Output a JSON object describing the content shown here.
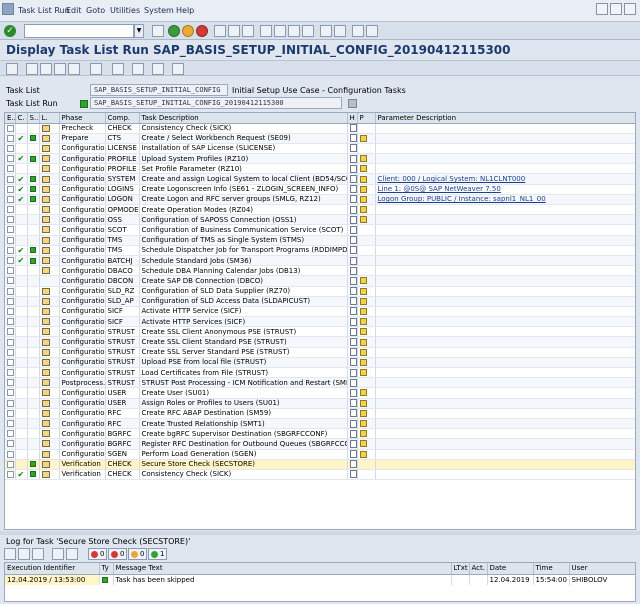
{
  "menu": {
    "items": [
      "Task List Run",
      "Edit",
      "Goto",
      "Utilities",
      "System",
      "Help"
    ]
  },
  "window": {
    "title": "Display Task List Run SAP_BASIS_SETUP_INITIAL_CONFIG_20190412115300"
  },
  "header": {
    "task_list_label": "Task List",
    "task_list_value": "SAP_BASIS_SETUP_INITIAL_CONFIG",
    "task_list_desc": "Initial Setup Use Case - Configuration Tasks",
    "task_list_run_label": "Task List Run",
    "task_list_run_value": "SAP_BASIS_SETUP_INITIAL_CONFIG_20190412115300"
  },
  "grid": {
    "columns": [
      "E..",
      "C.",
      "S..",
      "L.",
      "Phase",
      "Comp.",
      "Task Description",
      "H",
      "P",
      "Parameter Description"
    ],
    "rows": [
      {
        "e": true,
        "c": "",
        "s": false,
        "l": true,
        "phase": "Precheck",
        "comp": "CHECK",
        "desc": "Consistency Check (SICK)",
        "h": true,
        "p": false,
        "param": ""
      },
      {
        "e": true,
        "c": "✔",
        "s": true,
        "l": true,
        "phase": "Prepare",
        "comp": "CTS",
        "desc": "Create / Select Workbench Request (SE09)",
        "h": true,
        "p": true,
        "param": ""
      },
      {
        "e": true,
        "c": "",
        "s": false,
        "l": true,
        "phase": "Configuration",
        "comp": "LICENSE",
        "desc": "Installation of SAP License (SLICENSE)",
        "h": true,
        "p": false,
        "param": ""
      },
      {
        "e": true,
        "c": "✔",
        "s": true,
        "l": true,
        "phase": "Configuration",
        "comp": "PROFILE",
        "desc": "Upload System Profiles (RZ10)",
        "h": true,
        "p": true,
        "param": ""
      },
      {
        "e": true,
        "c": "",
        "s": false,
        "l": true,
        "phase": "Configuration",
        "comp": "PROFILE",
        "desc": "Set Profile Parameter (RZ10)",
        "h": true,
        "p": true,
        "param": ""
      },
      {
        "e": true,
        "c": "✔",
        "s": true,
        "l": true,
        "phase": "Configuration",
        "comp": "SYSTEM",
        "desc": "Create and assign Logical System to local Client (BD54/SCC4)",
        "h": true,
        "p": true,
        "param": "Client: 000 / Logical System: NL1CLNT000"
      },
      {
        "e": true,
        "c": "✔",
        "s": true,
        "l": true,
        "phase": "Configuration",
        "comp": "LOGINS",
        "desc": "Create Logonscreen Info (SE61 - ZLOGIN_SCREEN_INFO)",
        "h": true,
        "p": true,
        "param": "Line 1: @0S@   SAP NetWeaver 7.50"
      },
      {
        "e": true,
        "c": "✔",
        "s": true,
        "l": true,
        "phase": "Configuration",
        "comp": "LOGON",
        "desc": "Create Logon and RFC server groups (SMLG, RZ12)",
        "h": true,
        "p": true,
        "param": "Logon Group: PUBLIC / Instance: sapnl1_NL1_00"
      },
      {
        "e": true,
        "c": "",
        "s": false,
        "l": true,
        "phase": "Configuration",
        "comp": "OPMODE",
        "desc": "Create Operation Modes (RZ04)",
        "h": true,
        "p": true,
        "param": ""
      },
      {
        "e": true,
        "c": "",
        "s": false,
        "l": true,
        "phase": "Configuration",
        "comp": "OSS",
        "desc": "Configuration of SAPOSS Connection (OSS1)",
        "h": true,
        "p": true,
        "param": ""
      },
      {
        "e": true,
        "c": "",
        "s": false,
        "l": true,
        "phase": "Configuration",
        "comp": "SCOT",
        "desc": "Configuration of Business Communication Service (SCOT)",
        "h": true,
        "p": false,
        "param": ""
      },
      {
        "e": true,
        "c": "",
        "s": false,
        "l": true,
        "phase": "Configuration",
        "comp": "TMS",
        "desc": "Configuration of TMS as Single System (STMS)",
        "h": true,
        "p": false,
        "param": ""
      },
      {
        "e": true,
        "c": "✔",
        "s": true,
        "l": true,
        "phase": "Configuration",
        "comp": "TMS",
        "desc": "Schedule Dispatcher Job for Transport Programs (RDDIMPDP)",
        "h": true,
        "p": false,
        "param": ""
      },
      {
        "e": true,
        "c": "✔",
        "s": true,
        "l": true,
        "phase": "Configuration",
        "comp": "BATCHJ",
        "desc": "Schedule Standard Jobs (SM36)",
        "h": true,
        "p": false,
        "param": ""
      },
      {
        "e": true,
        "c": "",
        "s": false,
        "l": true,
        "phase": "Configuration",
        "comp": "DBACO",
        "desc": "Schedule DBA Planning Calendar Jobs (DB13)",
        "h": true,
        "p": false,
        "param": ""
      },
      {
        "e": true,
        "c": "",
        "s": false,
        "l": false,
        "phase": "Configuration",
        "comp": "DBCON",
        "desc": "Create SAP DB Connection (DBCO)",
        "h": true,
        "p": true,
        "param": ""
      },
      {
        "e": true,
        "c": "",
        "s": false,
        "l": true,
        "phase": "Configuration",
        "comp": "SLD_RZ",
        "desc": "Configuration of SLD Data Supplier (RZ70)",
        "h": true,
        "p": true,
        "param": ""
      },
      {
        "e": true,
        "c": "",
        "s": false,
        "l": true,
        "phase": "Configuration",
        "comp": "SLD_AP",
        "desc": "Configuration of SLD Access Data (SLDAPICUST)",
        "h": true,
        "p": true,
        "param": ""
      },
      {
        "e": true,
        "c": "",
        "s": false,
        "l": true,
        "phase": "Configuration",
        "comp": "SICF",
        "desc": "Activate HTTP Service (SICF)",
        "h": true,
        "p": true,
        "param": ""
      },
      {
        "e": true,
        "c": "",
        "s": false,
        "l": true,
        "phase": "Configuration",
        "comp": "SICF",
        "desc": "Activate HTTP Services (SICF)",
        "h": true,
        "p": true,
        "param": ""
      },
      {
        "e": true,
        "c": "",
        "s": false,
        "l": true,
        "phase": "Configuration",
        "comp": "STRUST",
        "desc": "Create SSL Client Anonymous PSE (STRUST)",
        "h": true,
        "p": true,
        "param": ""
      },
      {
        "e": true,
        "c": "",
        "s": false,
        "l": true,
        "phase": "Configuration",
        "comp": "STRUST",
        "desc": "Create SSL Client Standard PSE (STRUST)",
        "h": true,
        "p": true,
        "param": ""
      },
      {
        "e": true,
        "c": "",
        "s": false,
        "l": true,
        "phase": "Configuration",
        "comp": "STRUST",
        "desc": "Create SSL Server Standard PSE (STRUST)",
        "h": true,
        "p": true,
        "param": ""
      },
      {
        "e": true,
        "c": "",
        "s": false,
        "l": true,
        "phase": "Configuration",
        "comp": "STRUST",
        "desc": "Upload PSE from local file (STRUST)",
        "h": true,
        "p": true,
        "param": ""
      },
      {
        "e": true,
        "c": "",
        "s": false,
        "l": true,
        "phase": "Configuration",
        "comp": "STRUST",
        "desc": "Load Certificates from File (STRUST)",
        "h": true,
        "p": true,
        "param": ""
      },
      {
        "e": true,
        "c": "",
        "s": false,
        "l": true,
        "phase": "Postprocess...",
        "comp": "STRUST",
        "desc": "STRUST Post Processing - ICM Notification and Restart (SMIC",
        "h": true,
        "p": false,
        "param": ""
      },
      {
        "e": true,
        "c": "",
        "s": false,
        "l": true,
        "phase": "Configuration",
        "comp": "USER",
        "desc": "Create User (SU01)",
        "h": true,
        "p": true,
        "param": ""
      },
      {
        "e": true,
        "c": "",
        "s": false,
        "l": true,
        "phase": "Configuration",
        "comp": "USER",
        "desc": "Assign Roles or Profiles to Users (SU01)",
        "h": true,
        "p": true,
        "param": ""
      },
      {
        "e": true,
        "c": "",
        "s": false,
        "l": true,
        "phase": "Configuration",
        "comp": "RFC",
        "desc": "Create RFC ABAP Destination (SM59)",
        "h": true,
        "p": true,
        "param": ""
      },
      {
        "e": true,
        "c": "",
        "s": false,
        "l": true,
        "phase": "Configuration",
        "comp": "RFC",
        "desc": "Create Trusted Relationship (SMT1)",
        "h": true,
        "p": true,
        "param": ""
      },
      {
        "e": true,
        "c": "",
        "s": false,
        "l": true,
        "phase": "Configuration",
        "comp": "BGRFC",
        "desc": "Create bgRFC Supervisor Destination (SBGRFCCONF)",
        "h": true,
        "p": true,
        "param": ""
      },
      {
        "e": true,
        "c": "",
        "s": false,
        "l": true,
        "phase": "Configuration",
        "comp": "BGRFC",
        "desc": "Register RFC Destination for Outbound Queues (SBGRFCCONF)",
        "h": true,
        "p": true,
        "param": ""
      },
      {
        "e": true,
        "c": "",
        "s": false,
        "l": true,
        "phase": "Configuration",
        "comp": "SGEN",
        "desc": "Perform Load Generation (SGEN)",
        "h": true,
        "p": true,
        "param": ""
      },
      {
        "e": true,
        "c": "",
        "s": true,
        "l": true,
        "phase": "Verification",
        "comp": "CHECK",
        "desc": "Secure Store Check (SECSTORE)",
        "h": true,
        "p": false,
        "param": "",
        "selected": true
      },
      {
        "e": true,
        "c": "✔",
        "s": true,
        "l": true,
        "phase": "Verification",
        "comp": "CHECK",
        "desc": "Consistency Check (SICK)",
        "h": true,
        "p": false,
        "param": ""
      }
    ]
  },
  "log": {
    "title": "Log for Task 'Secure Store Check (SECSTORE)'",
    "badges": [
      "0",
      "0",
      "0",
      "1"
    ],
    "columns": [
      "Execution Identifier",
      "Ty",
      "Message Text",
      "LTxt",
      "Act.",
      "Date",
      "Time",
      "User"
    ],
    "rows": [
      {
        "id": "12.04.2019 / 13:53:00",
        "ty": "",
        "text": "Task has been skipped",
        "ltxt": "",
        "act": "",
        "date": "12.04.2019",
        "time": "15:54:00",
        "user": "SHIBOLOV"
      }
    ]
  },
  "colors": {
    "title": "#1c3a6e",
    "green_status": "#2fa52f",
    "selected_row": "#fff5c8"
  }
}
